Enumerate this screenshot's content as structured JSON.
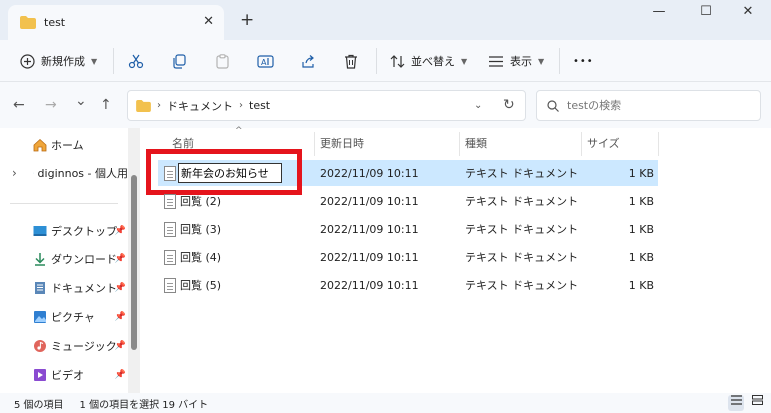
{
  "window": {
    "tab_title": "test",
    "tab_close": "✕",
    "new_tab": "+",
    "minimize": "—",
    "maximize": "☐",
    "close": "✕"
  },
  "toolbar": {
    "new_label": "新規作成",
    "sort_label": "並べ替え",
    "view_label": "表示",
    "more_label": "•••"
  },
  "nav": {
    "back": "←",
    "forward": "→",
    "recent": "⌄",
    "up": "↑"
  },
  "address": {
    "segments": [
      "ドキュメント",
      "test"
    ],
    "separator": "›"
  },
  "search": {
    "placeholder": "testの検索"
  },
  "sidebar": {
    "items": [
      {
        "label": "ホーム",
        "icon": "home-icon"
      },
      {
        "label": "diginnos - 個人用",
        "icon": "onedrive-icon"
      },
      {
        "label": "デスクトップ",
        "icon": "desktop-icon",
        "pinned": true
      },
      {
        "label": "ダウンロード",
        "icon": "download-icon",
        "pinned": true
      },
      {
        "label": "ドキュメント",
        "icon": "documents-icon",
        "pinned": true
      },
      {
        "label": "ピクチャ",
        "icon": "pictures-icon",
        "pinned": true
      },
      {
        "label": "ミュージック",
        "icon": "music-icon",
        "pinned": true
      },
      {
        "label": "ビデオ",
        "icon": "video-icon",
        "pinned": true
      }
    ],
    "expand_glyph": "›",
    "pin_glyph": "📌"
  },
  "table": {
    "columns": [
      "名前",
      "更新日時",
      "種類",
      "サイズ"
    ],
    "sort_indicator": "^",
    "rows": [
      {
        "name": "新年会のお知らせ",
        "date": "2022/11/09 10:11",
        "type": "テキスト ドキュメント",
        "size": "1 KB",
        "selected": true
      },
      {
        "name": "回覧 (2)",
        "date": "2022/11/09 10:11",
        "type": "テキスト ドキュメント",
        "size": "1 KB"
      },
      {
        "name": "回覧 (3)",
        "date": "2022/11/09 10:11",
        "type": "テキスト ドキュメント",
        "size": "1 KB"
      },
      {
        "name": "回覧 (4)",
        "date": "2022/11/09 10:11",
        "type": "テキスト ドキュメント",
        "size": "1 KB"
      },
      {
        "name": "回覧 (5)",
        "date": "2022/11/09 10:11",
        "type": "テキスト ドキュメント",
        "size": "1 KB"
      }
    ]
  },
  "status": {
    "item_count": "5 個の項目",
    "selection": "1 個の項目を選択  19 バイト"
  },
  "colors": {
    "selection": "#cce8ff",
    "highlight": "#e5141c",
    "folder": "#f2c14e",
    "onedrive": "#0f6cbd"
  }
}
